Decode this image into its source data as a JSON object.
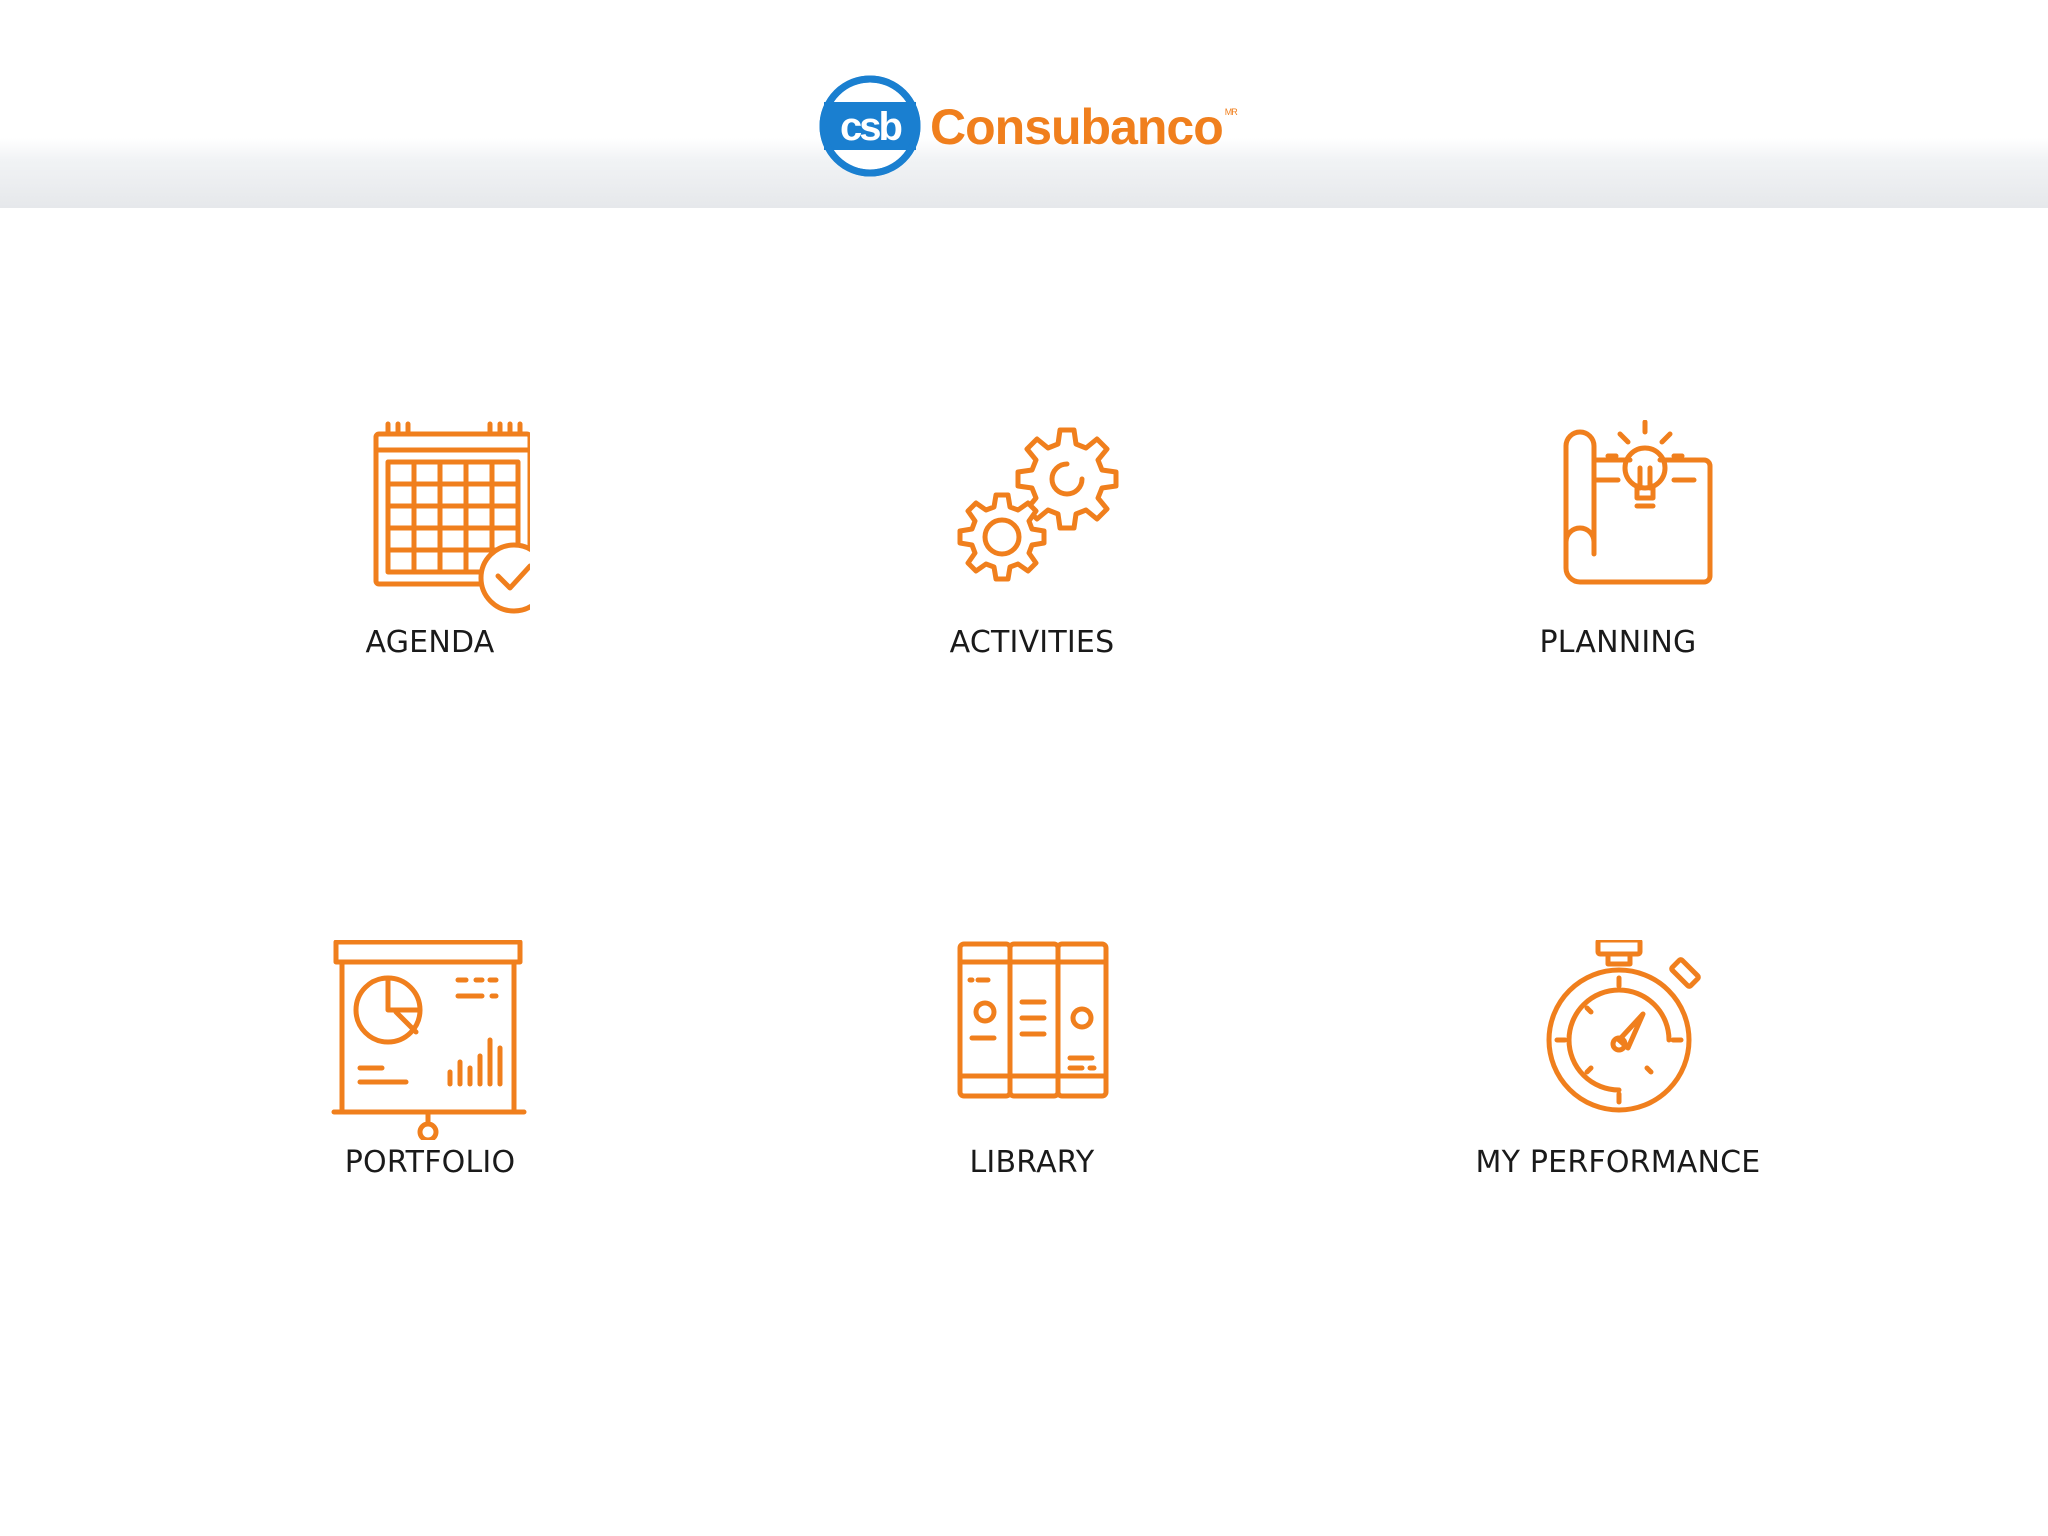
{
  "header": {
    "logo": {
      "mark_text": "csb",
      "wordmark": "Consubanco",
      "tm": "MR",
      "mark_color": "#1a7fd0",
      "word_color": "#f07f1d"
    }
  },
  "accent_color": "#f07f1d",
  "menu": {
    "items": [
      {
        "label": "AGENDA",
        "icon": "calendar-check-icon"
      },
      {
        "label": "ACTIVITIES",
        "icon": "gears-icon"
      },
      {
        "label": "PLANNING",
        "icon": "blueprint-lightbulb-icon"
      },
      {
        "label": "PORTFOLIO",
        "icon": "presentation-board-icon"
      },
      {
        "label": "LIBRARY",
        "icon": "binders-icon"
      },
      {
        "label": "MY PERFORMANCE",
        "icon": "stopwatch-icon"
      }
    ]
  }
}
